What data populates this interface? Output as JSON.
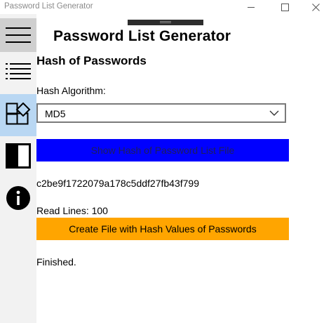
{
  "window": {
    "title": "Password List Generator"
  },
  "sidebar": {
    "items": [
      {
        "icon": "hamburger-menu-icon"
      },
      {
        "icon": "list-icon"
      },
      {
        "icon": "shapes-icon",
        "selected": true
      },
      {
        "icon": "contrast-icon"
      },
      {
        "icon": "info-icon"
      }
    ]
  },
  "header": {
    "title": "Password List Generator"
  },
  "main": {
    "section_title": "Hash of Passwords",
    "algorithm_label": "Hash Algorithm:",
    "algorithm_value": "MD5",
    "show_hash_button": "Show Hash of Password List File",
    "hash_value": "c2be9f1722079a178c5ddf27fb43f799",
    "read_lines": "Read Lines: 100",
    "create_file_button": "Create File with Hash Values of Passwords",
    "status": "Finished."
  },
  "colors": {
    "show_hash_button_bg": "#0000ff",
    "create_file_button_bg": "#ffa500",
    "selected_nav_bg": "#b9d7f3"
  }
}
